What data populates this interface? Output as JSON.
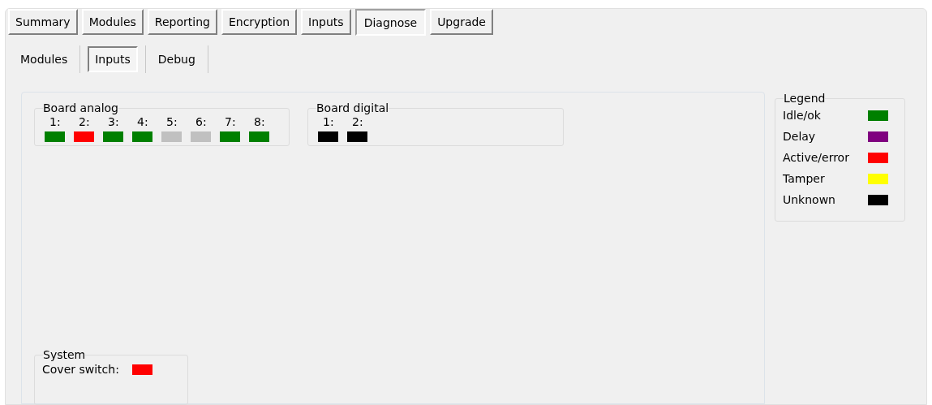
{
  "tabs": [
    {
      "label": "Summary",
      "selected": false
    },
    {
      "label": "Modules",
      "selected": false
    },
    {
      "label": "Reporting",
      "selected": false
    },
    {
      "label": "Encryption",
      "selected": false
    },
    {
      "label": "Inputs",
      "selected": false
    },
    {
      "label": "Diagnose",
      "selected": true
    },
    {
      "label": "Upgrade",
      "selected": false
    }
  ],
  "subtabs": [
    {
      "label": "Modules",
      "selected": false
    },
    {
      "label": "Inputs",
      "selected": true
    },
    {
      "label": "Debug",
      "selected": false
    }
  ],
  "board_analog": {
    "title": "Board analog",
    "inputs": [
      {
        "label": "1:",
        "color": "#008000"
      },
      {
        "label": "2:",
        "color": "#ff0000"
      },
      {
        "label": "3:",
        "color": "#008000"
      },
      {
        "label": "4:",
        "color": "#008000"
      },
      {
        "label": "5:",
        "color": "#c0c0c0"
      },
      {
        "label": "6:",
        "color": "#c0c0c0"
      },
      {
        "label": "7:",
        "color": "#008000"
      },
      {
        "label": "8:",
        "color": "#008000"
      }
    ]
  },
  "board_digital": {
    "title": "Board digital",
    "inputs": [
      {
        "label": "1:",
        "color": "#000000"
      },
      {
        "label": "2:",
        "color": "#000000"
      }
    ]
  },
  "system": {
    "title": "System",
    "items": [
      {
        "label": "Cover switch:",
        "color": "#ff0000"
      }
    ]
  },
  "legend": {
    "title": "Legend",
    "items": [
      {
        "label": "Idle/ok",
        "color": "#008000"
      },
      {
        "label": "Delay",
        "color": "#800080"
      },
      {
        "label": "Active/error",
        "color": "#ff0000"
      },
      {
        "label": "Tamper",
        "color": "#ffff00"
      },
      {
        "label": "Unknown",
        "color": "#000000"
      }
    ]
  }
}
